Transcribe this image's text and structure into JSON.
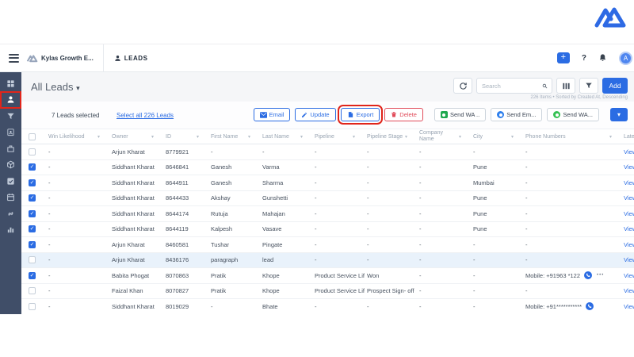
{
  "colors": {
    "accent": "#2b6ce3",
    "annotation_red": "#e0251b",
    "sidebar_bg": "#404e68",
    "whatsapp_green": "#27b35a",
    "email_circle_blue": "#2f80ed",
    "delete_red": "#e14b5a"
  },
  "navbar": {
    "app_name": "Kylas Growth E...",
    "module": "LEADS",
    "plus": "+",
    "help": "?",
    "avatar_initial": "A"
  },
  "sidebar": {
    "items": [
      {
        "icon": "dashboard-icon"
      },
      {
        "icon": "leads-icon",
        "active": true,
        "annotated": true
      },
      {
        "icon": "deals-icon"
      },
      {
        "icon": "contacts-icon"
      },
      {
        "icon": "companies-icon"
      },
      {
        "icon": "products-icon"
      },
      {
        "icon": "tasks-icon"
      },
      {
        "icon": "meetings-icon"
      },
      {
        "icon": "integrations-icon"
      },
      {
        "icon": "reports-icon"
      }
    ]
  },
  "page_header": {
    "title": "All Leads",
    "search_placeholder": "Search",
    "add_button": "Add",
    "sort_info": "226 Items • Sorted by Created At, Descending"
  },
  "action_bar": {
    "selected_text": "7 Leads selected",
    "select_all": "Select all 226 Leads",
    "email": "Email",
    "update": "Update",
    "export": "Export",
    "delete": "Delete",
    "send_wa": "Send WA ..",
    "send_email": "Send Em...",
    "send_wa_2": "Send WA..."
  },
  "table": {
    "headers": [
      "Win Likelihood",
      "Owner",
      "ID",
      "First Name",
      "Last Name",
      "Pipeline",
      "Pipeline Stage",
      "Company Name",
      "City",
      "Phone Numbers",
      "Latest"
    ],
    "view_label": "View",
    "more_indicator": "•••",
    "rows": [
      {
        "checked": false,
        "win": "-",
        "owner": "Arjun Kharat",
        "id": "8779921",
        "first_name": "-",
        "last_name": "-",
        "pipeline": "-",
        "stage": "-",
        "company": "-",
        "city": "-",
        "phone": "-"
      },
      {
        "checked": true,
        "win": "-",
        "owner": "Siddhant Kharat",
        "id": "8646841",
        "first_name": "Ganesh",
        "last_name": "Varma",
        "pipeline": "-",
        "stage": "-",
        "company": "-",
        "city": "Pune",
        "phone": "-"
      },
      {
        "checked": true,
        "win": "-",
        "owner": "Siddhant Kharat",
        "id": "8644911",
        "first_name": "Ganesh",
        "last_name": "Sharma",
        "pipeline": "-",
        "stage": "-",
        "company": "-",
        "city": "Mumbai",
        "phone": "-"
      },
      {
        "checked": true,
        "win": "-",
        "owner": "Siddhant Kharat",
        "id": "8644433",
        "first_name": "Akshay",
        "last_name": "Gunshetti",
        "pipeline": "-",
        "stage": "-",
        "company": "-",
        "city": "Pune",
        "phone": "-"
      },
      {
        "checked": true,
        "win": "-",
        "owner": "Siddhant Kharat",
        "id": "8644174",
        "first_name": "Rutuja",
        "last_name": "Mahajan",
        "pipeline": "-",
        "stage": "-",
        "company": "-",
        "city": "Pune",
        "phone": "-"
      },
      {
        "checked": true,
        "win": "-",
        "owner": "Siddhant Kharat",
        "id": "8644119",
        "first_name": "Kalpesh",
        "last_name": "Vasave",
        "pipeline": "-",
        "stage": "-",
        "company": "-",
        "city": "Pune",
        "phone": "-"
      },
      {
        "checked": true,
        "win": "-",
        "owner": "Arjun Kharat",
        "id": "8460581",
        "first_name": "Tushar",
        "last_name": "Pingate",
        "pipeline": "-",
        "stage": "-",
        "company": "-",
        "city": "-",
        "phone": "-"
      },
      {
        "checked": false,
        "highlighted": true,
        "win": "-",
        "owner": "Arjun Kharat",
        "id": "8436176",
        "first_name": "paragraph",
        "last_name": "lead",
        "pipeline": "-",
        "stage": "-",
        "company": "-",
        "city": "-",
        "phone": "-"
      },
      {
        "checked": true,
        "win": "-",
        "owner": "Babita Phogat",
        "id": "8070863",
        "first_name": "Pratik",
        "last_name": "Khope",
        "pipeline": "Product Service Life",
        "stage": "Won",
        "company": "-",
        "city": "-",
        "phone": "Mobile: +91963 *122",
        "phone_icon": true,
        "phone_more": true
      },
      {
        "checked": false,
        "win": "-",
        "owner": "Faizal Khan",
        "id": "8070827",
        "first_name": "Pratik",
        "last_name": "Khope",
        "pipeline": "Product Service Life",
        "stage": "Prospect Sign- off",
        "company": "-",
        "city": "-",
        "phone": "-"
      },
      {
        "checked": false,
        "win": "-",
        "owner": "Siddhant Kharat",
        "id": "8019029",
        "first_name": "-",
        "last_name": "Bhate",
        "pipeline": "-",
        "stage": "-",
        "company": "-",
        "city": "-",
        "phone": "Mobile: +91***********",
        "phone_icon": true
      }
    ]
  }
}
